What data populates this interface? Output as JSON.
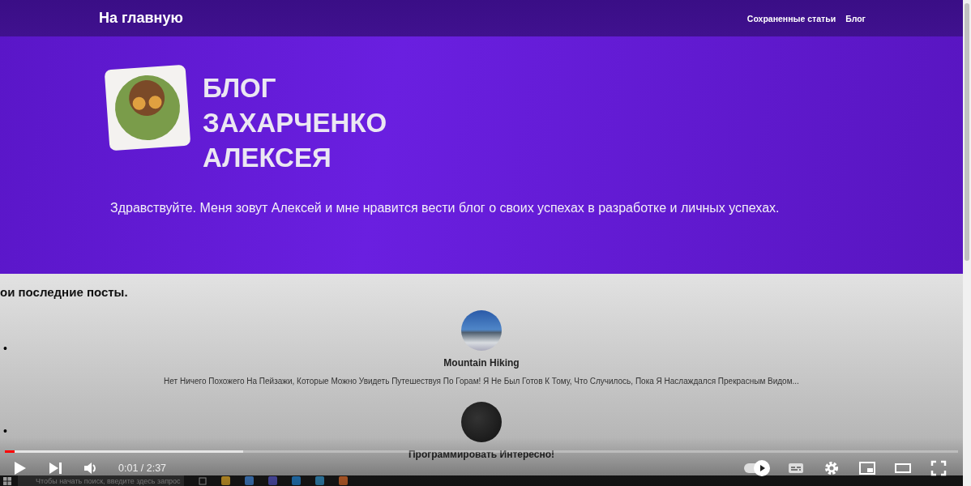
{
  "site_header": {
    "home_link": "На главную",
    "nav": [
      "Сохраненные статьи",
      "Блог"
    ]
  },
  "hero": {
    "title_lines": [
      "БЛОГ",
      "ЗАХАРЧЕНКО",
      "АЛЕКСЕЯ"
    ],
    "intro": "Здравствуйте. Меня зовут Алексей и мне нравится вести блог о своих успехах в разработке и личных успехах."
  },
  "posts_section": {
    "heading": "ои последние посты.",
    "posts": [
      {
        "marker": "•",
        "kind": "mountain",
        "title": "Mountain Hiking",
        "excerpt": "Нет Ничего Похожего На Пейзажи, Которые Можно Увидеть Путешествуя По Горам! Я Не Был Готов К Тому, Что Случилось, Пока Я Наслаждался Прекрасным Видом..."
      },
      {
        "marker": "•",
        "kind": "code",
        "title": "Программировать Интересно!"
      }
    ]
  },
  "taskbar": {
    "search": {
      "placeholder": "Чтобы начать поиск, введите здесь запрос"
    }
  },
  "player": {
    "progress": {
      "level": 0.01,
      "buffered": {
        "level": 0.25
      }
    },
    "time": "0:01 / 2:37",
    "autoplay": {
      "on": true
    }
  }
}
